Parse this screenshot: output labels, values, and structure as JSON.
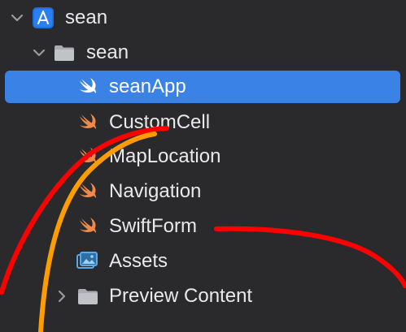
{
  "navigator": {
    "project": {
      "label": "sean",
      "icon": "xcode-project-icon",
      "expanded": true
    },
    "group": {
      "label": "sean",
      "icon": "folder-icon",
      "expanded": true
    },
    "files": [
      {
        "label": "seanApp",
        "icon": "swift-file-icon",
        "selected": true
      },
      {
        "label": "CustomCell",
        "icon": "swift-file-icon",
        "selected": false
      },
      {
        "label": "MapLocation",
        "icon": "swift-file-icon",
        "selected": false
      },
      {
        "label": "Navigation",
        "icon": "swift-file-icon",
        "selected": false
      },
      {
        "label": "SwiftForm",
        "icon": "swift-file-icon",
        "selected": false
      },
      {
        "label": "Assets",
        "icon": "asset-catalog-icon",
        "selected": false
      }
    ],
    "preview": {
      "label": "Preview Content",
      "icon": "folder-icon",
      "expanded": false
    }
  },
  "colors": {
    "background": "#2a2a2c",
    "selection": "#3a82e6",
    "swift_orange": "#f0894a",
    "annotation_red": "#ff0000",
    "annotation_orange": "#ff9d00"
  }
}
